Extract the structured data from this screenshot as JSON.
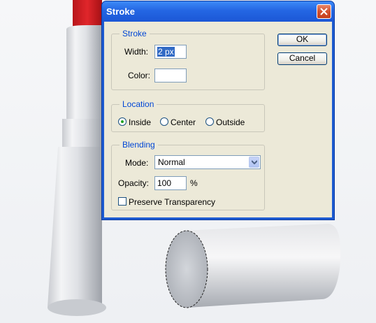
{
  "dialog": {
    "title": "Stroke",
    "ok_label": "OK",
    "cancel_label": "Cancel"
  },
  "stroke": {
    "legend": "Stroke",
    "width_label": "Width:",
    "width_value": "2 px",
    "color_label": "Color:",
    "color_value": "#ffffff"
  },
  "location": {
    "legend": "Location",
    "options": [
      {
        "label": "Inside",
        "selected": true
      },
      {
        "label": "Center",
        "selected": false
      },
      {
        "label": "Outside",
        "selected": false
      }
    ]
  },
  "blending": {
    "legend": "Blending",
    "mode_label": "Mode:",
    "mode_value": "Normal",
    "opacity_label": "Opacity:",
    "opacity_value": "100",
    "opacity_unit": "%",
    "preserve_label": "Preserve Transparency",
    "preserve_checked": false
  },
  "colors": {
    "title_bar": "#2466e3",
    "legend_text": "#0046d5",
    "client_bg": "#ece9d8",
    "lipstick_red": "#d11f22"
  }
}
